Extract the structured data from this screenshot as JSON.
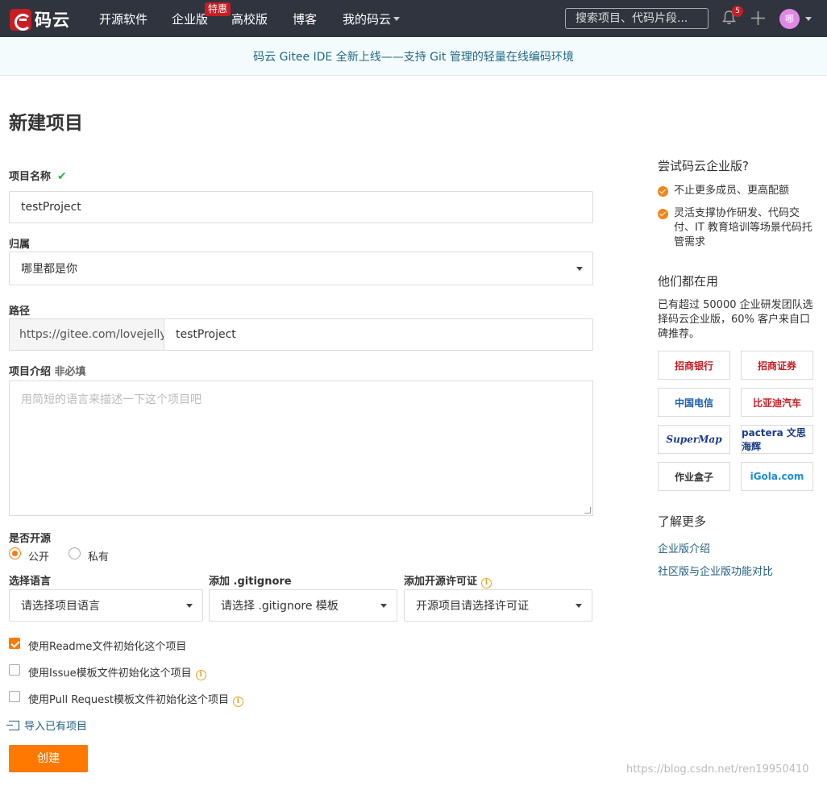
{
  "nav": {
    "logo_text": "码云",
    "links": [
      "开源软件",
      "企业版",
      "高校版",
      "博客",
      "我的码云"
    ],
    "hot_badge": "特惠",
    "search_placeholder": "搜索项目、代码片段...",
    "notification_count": "5",
    "avatar_text": "哪"
  },
  "banner": {
    "text": "码云 Gitee IDE 全新上线——支持 Git 管理的轻量在线编码环境"
  },
  "form": {
    "title": "新建项目",
    "name_label": "项目名称",
    "name_value": "testProject",
    "owner_label": "归属",
    "owner_value": "哪里都是你",
    "path_label": "路径",
    "path_prefix": "https://gitee.com/lovejelly/",
    "path_value": "testProject",
    "desc_label": "项目介绍",
    "desc_optional": "非必填",
    "desc_placeholder": "用简短的语言来描述一下这个项目吧",
    "visibility_label": "是否开源",
    "visibility_options": [
      "公开",
      "私有"
    ],
    "language_label": "选择语言",
    "language_value": "请选择项目语言",
    "gitignore_label": "添加 .gitignore",
    "gitignore_value": "请选择 .gitignore 模板",
    "license_label": "添加开源许可证",
    "license_value": "开源项目请选择许可证",
    "checkboxes": [
      {
        "label": "使用Readme文件初始化这个项目",
        "checked": true
      },
      {
        "label": "使用Issue模板文件初始化这个项目",
        "checked": false
      },
      {
        "label": "使用Pull Request模板文件初始化这个项目",
        "checked": false
      }
    ],
    "import_link": "导入已有项目",
    "submit_label": "创建"
  },
  "sidebar": {
    "try_title": "尝试码云企业版?",
    "bullets": [
      "不止更多成员、更高配额",
      "灵活支撑协作研发、代码交付、IT 教育培训等场景代码托管需求"
    ],
    "users_title": "他们都在用",
    "users_text": "已有超过 50000 企业研发团队选择码云企业版，60% 客户来自口碑推荐。",
    "logos": [
      "招商银行",
      "招商证券",
      "中国电信",
      "比亚迪汽车",
      "SuperMap",
      "pactera 文思海辉",
      "作业盒子",
      "iGola.com"
    ],
    "more_title": "了解更多",
    "links": [
      "企业版介绍",
      "社区版与企业版功能对比"
    ]
  },
  "watermark": "https://blog.csdn.net/ren19950410",
  "colors": {
    "primary": "#ff7800",
    "nav_bg": "#2f343e",
    "brand_red": "#c71d23",
    "link": "#1f5f80"
  }
}
